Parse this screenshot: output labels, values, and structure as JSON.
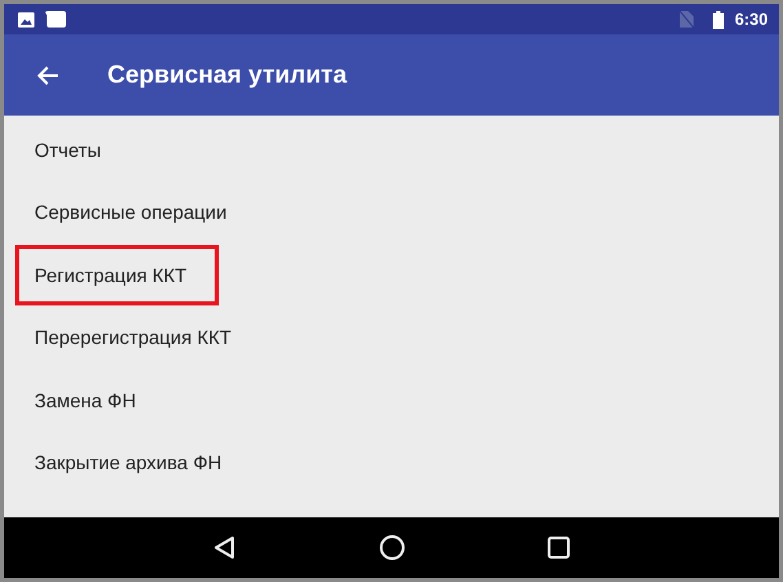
{
  "status_bar": {
    "time": "6:30"
  },
  "app_bar": {
    "title": "Сервисная утилита"
  },
  "menu_items": [
    {
      "label": "Отчеты",
      "highlighted": false
    },
    {
      "label": "Сервисные операции",
      "highlighted": false
    },
    {
      "label": "Регистрация ККТ",
      "highlighted": true
    },
    {
      "label": "Перерегистрация ККТ",
      "highlighted": false
    },
    {
      "label": "Замена ФН",
      "highlighted": false
    },
    {
      "label": "Закрытие архива ФН",
      "highlighted": false
    }
  ]
}
